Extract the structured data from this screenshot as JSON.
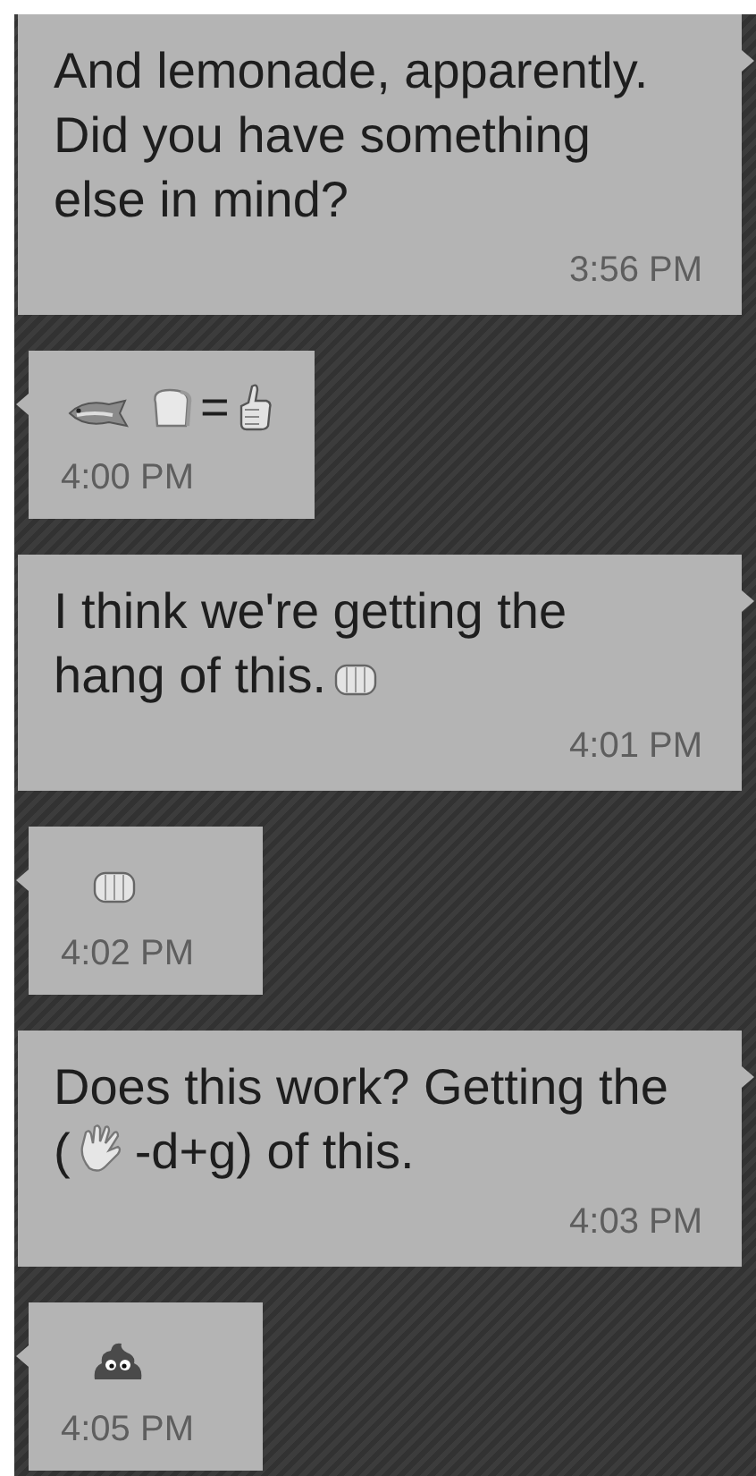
{
  "messages": [
    {
      "kind": "sent",
      "parts": [
        {
          "kind": "text",
          "text": "And lemonade, apparently. Did you have something else in mind?"
        }
      ],
      "time": "3:56 PM"
    },
    {
      "kind": "received",
      "parts": [
        {
          "kind": "fish"
        },
        {
          "kind": "bread"
        },
        {
          "kind": "text",
          "text": "="
        },
        {
          "kind": "thumbs-up"
        }
      ],
      "time": "4:00 PM"
    },
    {
      "kind": "sent",
      "parts": [
        {
          "kind": "text",
          "text": "I think we're getting the hang of this."
        },
        {
          "kind": "fist"
        }
      ],
      "time": "4:01 PM"
    },
    {
      "kind": "received",
      "parts": [
        {
          "kind": "fist"
        }
      ],
      "time": "4:02 PM"
    },
    {
      "kind": "sent",
      "parts": [
        {
          "kind": "text",
          "text": "Does this work? Getting the ("
        },
        {
          "kind": "hand"
        },
        {
          "kind": "text",
          "text": "-d+g) of this."
        }
      ],
      "time": "4:03 PM"
    },
    {
      "kind": "received",
      "parts": [
        {
          "kind": "poop"
        }
      ],
      "time": "4:05 PM"
    }
  ]
}
